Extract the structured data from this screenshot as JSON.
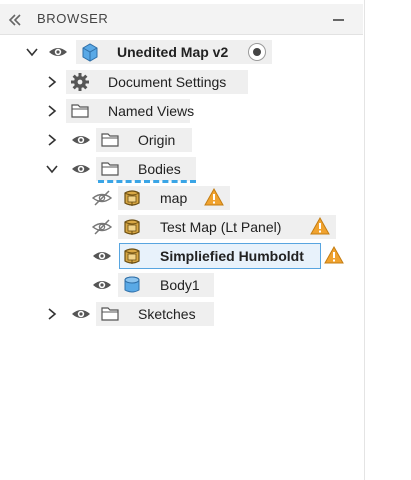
{
  "browser": {
    "title": "BROWSER",
    "root": {
      "label": "Unedited Map v2"
    },
    "nodes": {
      "document_settings": "Document Settings",
      "named_views": "Named Views",
      "origin": "Origin",
      "bodies": "Bodies",
      "sketches": "Sketches"
    },
    "bodies": {
      "map": "map",
      "test_map": "Test Map (Lt Panel)",
      "humboldt": "Simpliefied Humboldt",
      "body1": "Body1"
    }
  },
  "colors": {
    "accent": "#3aa5e6",
    "warning": "#f0a22e",
    "body_gold": "#d9a845",
    "body_blue": "#5aa9e6"
  },
  "icons": {
    "collapse": "double-chevron-left-icon",
    "minimize": "minus-icon",
    "eye": "eye-icon",
    "hidden": "eye-slash-icon",
    "gear": "gear-icon",
    "folder": "folder-icon",
    "component": "component-cube-icon",
    "body": "body-icon",
    "warning": "warning-icon",
    "active": "active-component-radio-icon"
  }
}
